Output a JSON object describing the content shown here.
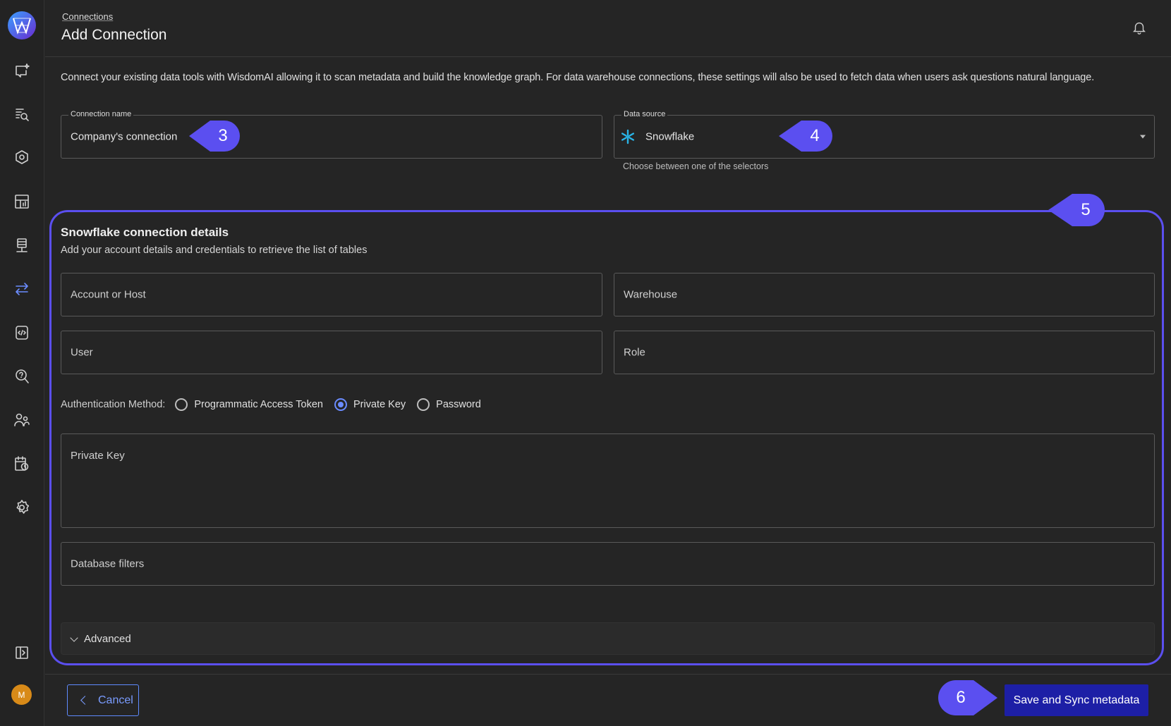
{
  "sidebar": {
    "items": [
      {
        "icon": "chat-sparkle-icon"
      },
      {
        "icon": "search-document-icon"
      },
      {
        "icon": "graph-hexagon-icon"
      },
      {
        "icon": "dashboard-chart-icon"
      },
      {
        "icon": "data-server-icon"
      },
      {
        "icon": "connections-arrows-icon",
        "active": true
      },
      {
        "icon": "code-file-icon"
      },
      {
        "icon": "help-search-icon"
      },
      {
        "icon": "users-icon"
      },
      {
        "icon": "calendar-clock-icon"
      },
      {
        "icon": "settings-gear-icon"
      }
    ],
    "collapse_icon": "collapse-panel-icon",
    "avatar_initial": "M",
    "accent_color": "#6b8cff"
  },
  "header": {
    "breadcrumb": "Connections",
    "title": "Add Connection"
  },
  "intro_text": "Connect your existing data tools with WisdomAI allowing it to scan metadata and build the knowledge graph. For data warehouse connections, these settings will also be used to fetch data when users ask questions natural language.",
  "form": {
    "connection_name_label": "Connection name",
    "connection_name_value": "Company's connection",
    "data_source_label": "Data source",
    "data_source_value": "Snowflake",
    "data_source_helper": "Choose between one of the selectors"
  },
  "details": {
    "title": "Snowflake connection details",
    "subtitle": "Add your account details and credentials to retrieve the list of tables",
    "account_placeholder": "Account or Host",
    "warehouse_placeholder": "Warehouse",
    "user_placeholder": "User",
    "role_placeholder": "Role",
    "auth_label": "Authentication Method:",
    "auth_options": [
      {
        "label": "Programmatic Access Token",
        "checked": false
      },
      {
        "label": "Private Key",
        "checked": true
      },
      {
        "label": "Password",
        "checked": false
      }
    ],
    "private_key_placeholder": "Private Key",
    "database_filters_placeholder": "Database filters",
    "advanced_label": "Advanced"
  },
  "callouts": {
    "c3": "3",
    "c4": "4",
    "c5": "5",
    "c6": "6",
    "color": "#5b4ff0"
  },
  "footer": {
    "cancel_label": "Cancel",
    "save_label": "Save and Sync metadata"
  }
}
